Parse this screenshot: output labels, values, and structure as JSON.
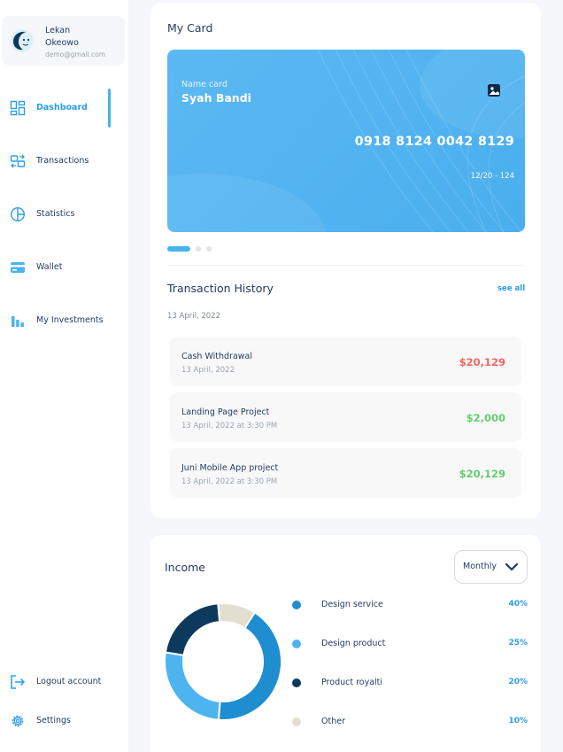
{
  "profile": {
    "first_name": "Lekan",
    "last_name": "Okeowo",
    "email": "demo@gmail.com"
  },
  "nav": [
    {
      "label": "Dashboard",
      "icon": "dashboard-icon",
      "active": true
    },
    {
      "label": "Transactions",
      "icon": "transactions-icon",
      "active": false
    },
    {
      "label": "Statistics",
      "icon": "statistics-icon",
      "active": false
    },
    {
      "label": "Wallet",
      "icon": "wallet-icon",
      "active": false
    },
    {
      "label": "My Investments",
      "icon": "investments-icon",
      "active": false
    }
  ],
  "bottom_nav": [
    {
      "label": "Logout account",
      "icon": "logout-icon"
    },
    {
      "label": "Settings",
      "icon": "settings-icon"
    }
  ],
  "my_card": {
    "title": "My Card",
    "name_label": "Name card",
    "name_value": "Syah Bandi",
    "number": "0918 8124 0042 8129",
    "expiry": "12/20 - 124",
    "card_icon": "image-icon",
    "carousel_dots": 3,
    "carousel_active": 0
  },
  "history": {
    "title": "Transaction History",
    "see_all": "see all",
    "date_header": "13 April, 2022",
    "items": [
      {
        "name": "Cash Withdrawal",
        "date": "13 April, 2022",
        "amount": "$20,129",
        "type": "debit"
      },
      {
        "name": "Landing Page Project",
        "date": "13 April, 2022 at 3:30 PM",
        "amount": "$2,000",
        "type": "credit"
      },
      {
        "name": "Juni Mobile App project",
        "date": "13 April, 2022 at 3:30 PM",
        "amount": "$20,129",
        "type": "credit"
      }
    ]
  },
  "income": {
    "title": "Income",
    "period": "Monthly",
    "period_icon": "chevron-down-icon"
  },
  "chart_data": {
    "type": "pie",
    "categories": [
      "Design service",
      "Design product",
      "Product royalti",
      "Other"
    ],
    "values": [
      40,
      25,
      20,
      10
    ],
    "value_labels": [
      "40%",
      "25%",
      "20%",
      "10%"
    ],
    "colors": [
      "#1f8ed0",
      "#4db4ef",
      "#0d3a5c",
      "#e2dfd1"
    ],
    "donut": true,
    "legend": "right"
  },
  "colors": {
    "accent": "#2a9ee8",
    "debit": "#f0675a",
    "credit": "#5fcf6d",
    "card": "#55b5f1"
  }
}
